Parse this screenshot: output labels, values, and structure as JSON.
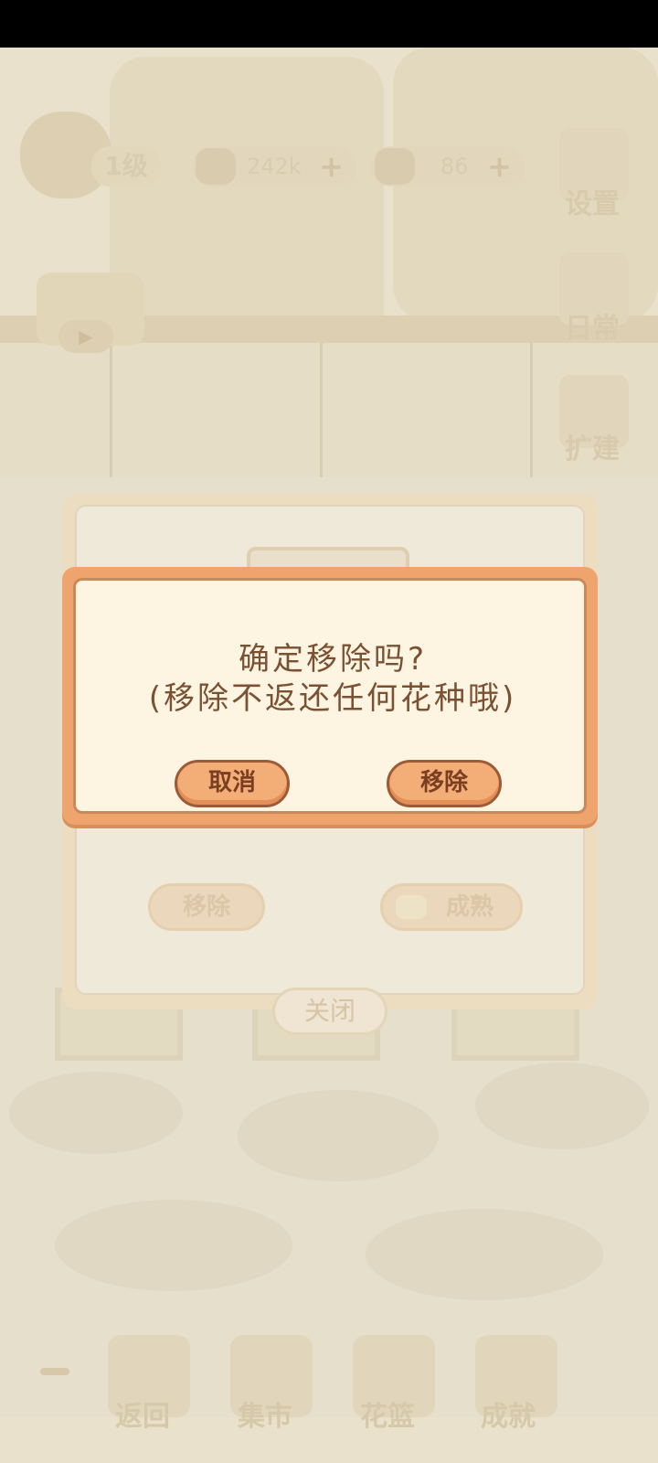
{
  "hud": {
    "level_label": "1级",
    "fish_count": "242k",
    "cheese_count": "86",
    "settings_label": "设置",
    "daily_label": "日常",
    "expand_label": "扩建"
  },
  "panel": {
    "remove_label": "移除",
    "mature_label": "成熟",
    "close_label": "关闭"
  },
  "dialog": {
    "line1": "确定移除吗?",
    "line2": "(移除不返还任何花种哦)",
    "cancel_label": "取消",
    "confirm_label": "移除"
  },
  "bottom_nav": {
    "back_label": "返回",
    "market_label": "集市",
    "basket_label": "花篮",
    "achievement_label": "成就"
  },
  "colors": {
    "dialog_border": "#efa46e",
    "dialog_bg": "#fdf5e2",
    "button_fill": "#f3ad77",
    "text": "#7a5133"
  }
}
